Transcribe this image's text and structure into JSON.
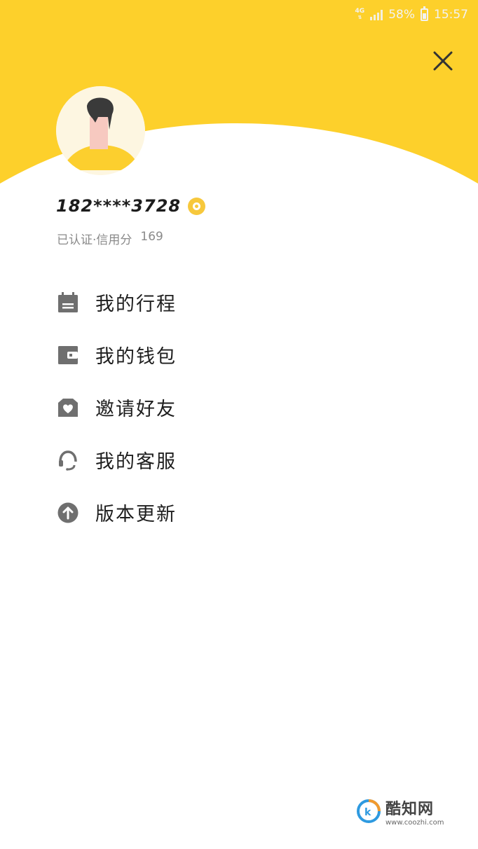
{
  "status_bar": {
    "network": "4G",
    "battery_percent": "58%",
    "time": "15:57"
  },
  "profile": {
    "phone": "182****3728",
    "verified_label": "已认证·信用分",
    "credit_score": "169"
  },
  "menu": {
    "items": [
      {
        "label": "我的行程",
        "icon": "itinerary-icon"
      },
      {
        "label": "我的钱包",
        "icon": "wallet-icon"
      },
      {
        "label": "邀请好友",
        "icon": "invite-gift-icon"
      },
      {
        "label": "我的客服",
        "icon": "headset-icon"
      },
      {
        "label": "版本更新",
        "icon": "upload-arrow-icon"
      }
    ]
  },
  "watermark": {
    "name": "酷知网",
    "url": "www.coozhi.com"
  },
  "colors": {
    "header_yellow": "#FDD02B",
    "icon_gray": "#6f6f6f",
    "badge_gold": "#F7C83C"
  }
}
